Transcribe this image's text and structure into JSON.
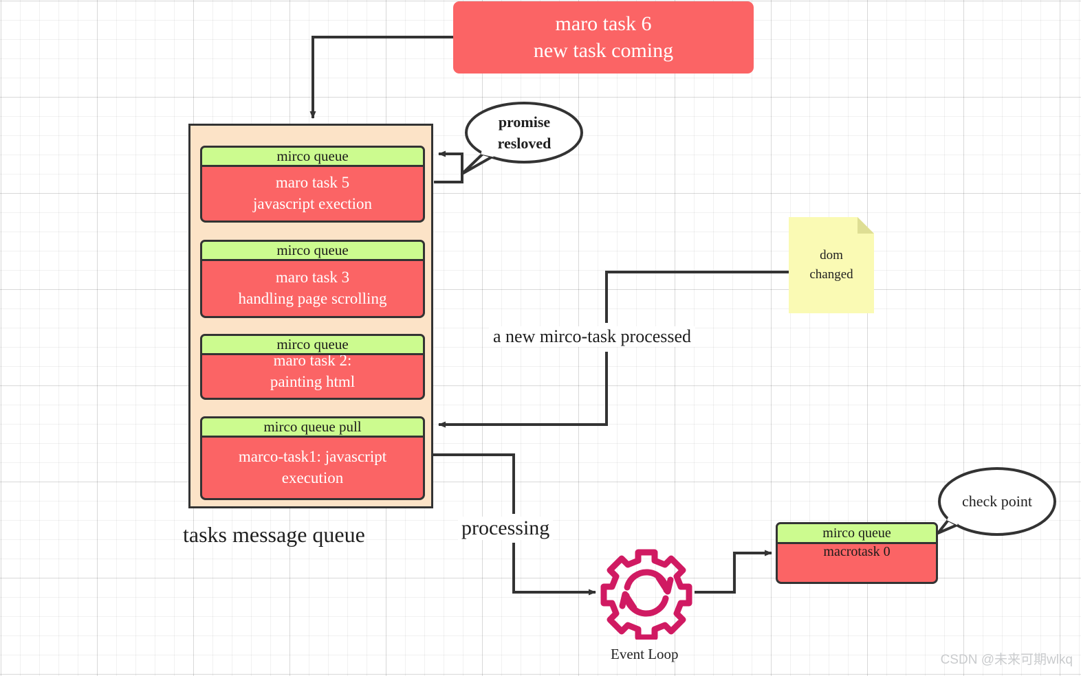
{
  "diagram": {
    "title": "JavaScript Event Loop / tasks message queue diagram",
    "colors": {
      "task_red": "#FB6465",
      "queue_green": "#CCFB8F",
      "container_peach": "#FCE3C7",
      "stroke_dark": "#333333",
      "note_yellow": "#FAFAB4",
      "event_loop_pink": "#D01A62",
      "watermark_gray": "#c9cbcd"
    }
  },
  "new_task_box": {
    "line1": "maro task 6",
    "line2": "new task coming"
  },
  "queue_container": {
    "caption": "tasks message queue",
    "items": [
      {
        "header": "mirco queue",
        "line1": "maro task 5",
        "line2": "javascript exection"
      },
      {
        "header": "mirco queue",
        "line1": "maro task 3",
        "line2": "handling page scrolling"
      },
      {
        "header": "mirco queue",
        "line1": "maro task 2:",
        "line2": "painting html"
      },
      {
        "header": "mirco queue pull",
        "line1": "marco-task1: javascript",
        "line2": "execution"
      }
    ]
  },
  "bubbles": {
    "promise": {
      "line1": "promise",
      "line2": "resloved"
    },
    "check_point": {
      "line1": "check point"
    }
  },
  "sticky_note": {
    "line1": "dom",
    "line2": "changed"
  },
  "labels": {
    "microtask_processed": "a new mirco-task processed",
    "processing": "processing",
    "event_loop": "Event Loop"
  },
  "macrotask_box": {
    "header": "mirco queue",
    "body": "macrotask 0"
  },
  "watermark": {
    "text": "CSDN @未来可期wlkq"
  }
}
